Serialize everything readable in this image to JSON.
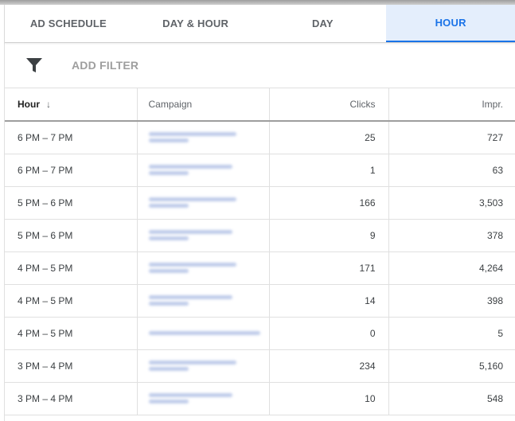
{
  "tabs": [
    {
      "label": "AD SCHEDULE",
      "active": false
    },
    {
      "label": "DAY & HOUR",
      "active": false
    },
    {
      "label": "DAY",
      "active": false
    },
    {
      "label": "HOUR",
      "active": true
    }
  ],
  "filter": {
    "label": "ADD FILTER",
    "icon": "filter-icon"
  },
  "table": {
    "headers": {
      "hour": "Hour",
      "campaign": "Campaign",
      "clicks": "Clicks",
      "impr": "Impr."
    },
    "sort_icon": "↓",
    "rows": [
      {
        "hour": "6 PM – 7 PM",
        "clicks": "25",
        "impr": "727"
      },
      {
        "hour": "6 PM – 7 PM",
        "clicks": "1",
        "impr": "63"
      },
      {
        "hour": "5 PM – 6 PM",
        "clicks": "166",
        "impr": "3,503"
      },
      {
        "hour": "5 PM – 6 PM",
        "clicks": "9",
        "impr": "378"
      },
      {
        "hour": "4 PM – 5 PM",
        "clicks": "171",
        "impr": "4,264"
      },
      {
        "hour": "4 PM – 5 PM",
        "clicks": "14",
        "impr": "398"
      },
      {
        "hour": "4 PM – 5 PM",
        "clicks": "0",
        "impr": "5"
      },
      {
        "hour": "3 PM – 4 PM",
        "clicks": "234",
        "impr": "5,160"
      },
      {
        "hour": "3 PM – 4 PM",
        "clicks": "10",
        "impr": "548"
      }
    ]
  },
  "colors": {
    "accent": "#1a73e8",
    "active_tab_bg": "#e4eefc"
  }
}
